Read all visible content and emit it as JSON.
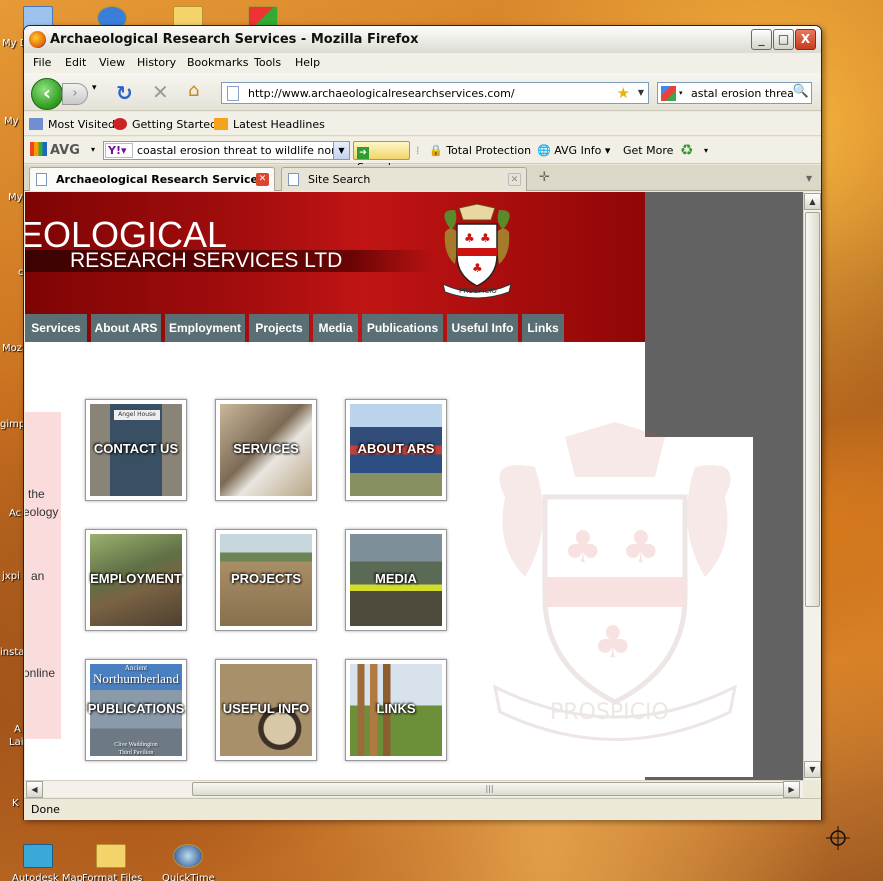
{
  "desktop": {
    "side_labels": [
      "My D",
      "My",
      "My",
      "c",
      "Moz",
      "gimp",
      "Ac",
      "jxpi",
      "insta",
      "A",
      "Lai",
      "K"
    ],
    "bottom_icons": [
      "Autodesk Map",
      "Format Files",
      "QuickTime"
    ]
  },
  "window": {
    "title": "Archaeological Research Services - Mozilla Firefox",
    "controls": {
      "minimize": "_",
      "maximize": "□",
      "close": "X"
    }
  },
  "menu": [
    "File",
    "Edit",
    "View",
    "History",
    "Bookmarks",
    "Tools",
    "Help"
  ],
  "nav": {
    "url": "http://www.archaeologicalresearchservices.com/",
    "search_value": "astal erosion threat l"
  },
  "bookmarks": [
    "Most Visited",
    "Getting Started",
    "Latest Headlines"
  ],
  "avg_toolbar": {
    "logo": "AVG",
    "yahoo": "Y!",
    "search_value": "coastal erosion threat to wildlife north e",
    "search_button": "Search",
    "items": [
      "Total Protection",
      "AVG Info",
      "Get More"
    ]
  },
  "tabs": [
    {
      "label": "Archaeological Research Services",
      "active": true
    },
    {
      "label": "Site Search",
      "active": false
    }
  ],
  "site": {
    "title_line1": "EOLOGICAL",
    "title_line2": "RESEARCH SERVICES LTD",
    "crest_motto": "PROSPICIO",
    "nav": [
      "Services",
      "About ARS",
      "Employment",
      "Projects",
      "Media",
      "Publications",
      "Useful Info",
      "Links"
    ],
    "sidebar_text": [
      "the",
      "eology",
      "an",
      "online"
    ],
    "tiles": [
      {
        "label": "CONTACT US",
        "sign": "Angel House"
      },
      {
        "label": "SERVICES"
      },
      {
        "label": "ABOUT ARS"
      },
      {
        "label": "EMPLOYMENT"
      },
      {
        "label": "PROJECTS"
      },
      {
        "label": "MEDIA"
      },
      {
        "label": "PUBLICATIONS",
        "book_top": "Ancient",
        "book_title": "Northumberland",
        "book_bottom": "Clive Waddington",
        "book_sub": "Third Pavilion"
      },
      {
        "label": "USEFUL INFO"
      },
      {
        "label": "LINKS"
      }
    ]
  },
  "status": "Done"
}
